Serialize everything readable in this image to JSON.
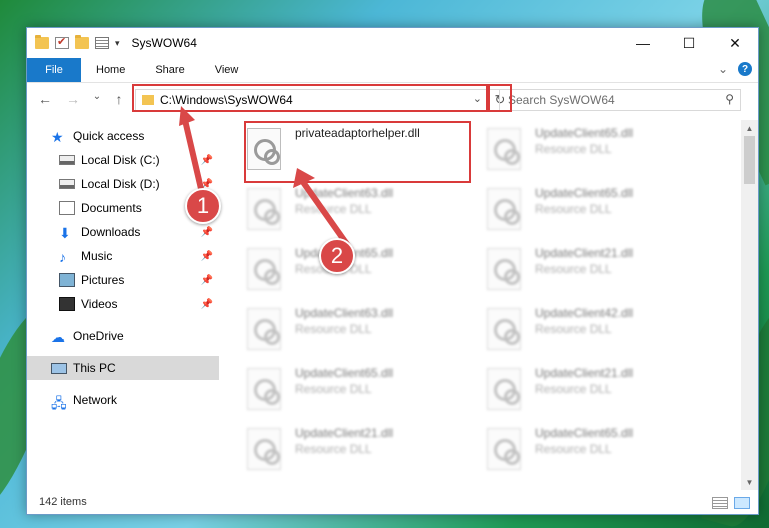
{
  "window": {
    "title": "SysWOW64"
  },
  "titlebar": {
    "minimize": "—",
    "maximize": "☐",
    "close": "✕"
  },
  "ribbon": {
    "file": "File",
    "tabs": [
      "Home",
      "Share",
      "View"
    ],
    "expand": "⌄",
    "help": "?"
  },
  "nav": {
    "back": "←",
    "forward": "→",
    "recent": "⌄",
    "up": "↑",
    "address": "C:\\Windows\\SysWOW64",
    "address_dd": "⌄",
    "refresh": "↻",
    "search_placeholder": "Search SysWOW64"
  },
  "sidebar": {
    "items": [
      {
        "label": "Quick access",
        "icon": "quick-access-star-icon",
        "pinned": false
      },
      {
        "label": "Local Disk (C:)",
        "icon": "drive-icon",
        "pinned": true
      },
      {
        "label": "Local Disk (D:)",
        "icon": "drive-icon",
        "pinned": true
      },
      {
        "label": "Documents",
        "icon": "documents-icon",
        "pinned": true
      },
      {
        "label": "Downloads",
        "icon": "downloads-icon",
        "pinned": true
      },
      {
        "label": "Music",
        "icon": "music-icon",
        "pinned": true
      },
      {
        "label": "Pictures",
        "icon": "pictures-icon",
        "pinned": true
      },
      {
        "label": "Videos",
        "icon": "videos-icon",
        "pinned": true
      },
      {
        "label": "OneDrive",
        "icon": "onedrive-icon",
        "pinned": false
      },
      {
        "label": "This PC",
        "icon": "this-pc-icon",
        "pinned": false,
        "selected": true
      },
      {
        "label": "Network",
        "icon": "network-icon",
        "pinned": false
      }
    ],
    "pin_glyph": "📌"
  },
  "files": [
    {
      "name": "privateadaptorhelper.dll",
      "type": ""
    },
    {
      "name": "UpdateClient65.dll",
      "type": "Resource DLL"
    },
    {
      "name": "UpdateClient63.dll",
      "type": "Resource DLL"
    },
    {
      "name": "UpdateClient65.dll",
      "type": "Resource DLL"
    },
    {
      "name": "UpdateClient65.dll",
      "type": "Resource DLL"
    },
    {
      "name": "UpdateClient21.dll",
      "type": "Resource DLL"
    },
    {
      "name": "UpdateClient63.dll",
      "type": "Resource DLL"
    },
    {
      "name": "UpdateClient42.dll",
      "type": "Resource DLL"
    },
    {
      "name": "UpdateClient65.dll",
      "type": "Resource DLL"
    },
    {
      "name": "UpdateClient21.dll",
      "type": "Resource DLL"
    },
    {
      "name": "UpdateClient21.dll",
      "type": "Resource DLL"
    },
    {
      "name": "UpdateClient65.dll",
      "type": "Resource DLL"
    }
  ],
  "status": {
    "count": "142 items"
  },
  "annotations": {
    "badge1": "1",
    "badge2": "2",
    "color": "#d93a3a"
  }
}
